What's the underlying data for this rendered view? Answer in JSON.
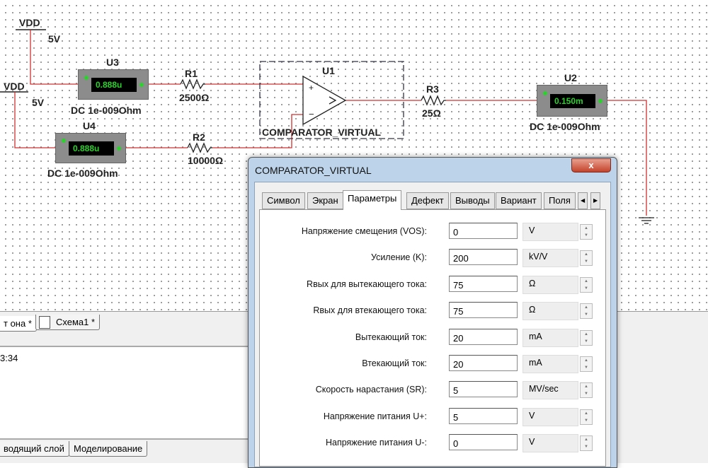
{
  "schematic": {
    "vdd": [
      {
        "label": "VDD",
        "voltage": "5V"
      },
      {
        "label": "VDD",
        "voltage": "5V"
      }
    ],
    "meters": [
      {
        "ref": "U3",
        "reading": "0.888u",
        "caption": "DC  1e-009Ohm"
      },
      {
        "ref": "U4",
        "reading": "0.888u",
        "caption": "DC  1e-009Ohm"
      },
      {
        "ref": "U2",
        "reading": "0.150m",
        "caption": "DC  1e-009Ohm"
      }
    ],
    "resistors": [
      {
        "ref": "R1",
        "value": "2500Ω"
      },
      {
        "ref": "R2",
        "value": "10000Ω"
      },
      {
        "ref": "R3",
        "value": "25Ω"
      }
    ],
    "comparator": {
      "ref": "U1",
      "name": "COMPARATOR_VIRTUAL",
      "plus": "+",
      "minus": "−"
    }
  },
  "colors": {
    "wire": "#d03030",
    "display_text": "#2dd12d"
  },
  "lower": {
    "doc_tabs": [
      "т она *",
      "Схема1 *"
    ],
    "output_text": "3:34",
    "bottom_tabs": [
      "водящий слой",
      "Моделирование"
    ]
  },
  "dialog": {
    "title": "COMPARATOR_VIRTUAL",
    "close": "x",
    "tabs": [
      "Символ",
      "Экран",
      "Параметры",
      "Дефект",
      "Выводы",
      "Вариант",
      "Поля"
    ],
    "active_tab": "Параметры",
    "params": [
      {
        "label": "Напряжение смещения (VOS):",
        "value": "0",
        "unit": "V"
      },
      {
        "label": "Усиление (K):",
        "value": "200",
        "unit": "kV/V"
      },
      {
        "label": "Rвых для вытекающего тока:",
        "value": "75",
        "unit": "Ω"
      },
      {
        "label": "Rвых для втекающего тока:",
        "value": "75",
        "unit": "Ω"
      },
      {
        "label": "Вытекающий ток:",
        "value": "20",
        "unit": "mA"
      },
      {
        "label": "Втекающий ток:",
        "value": "20",
        "unit": "mA"
      },
      {
        "label": "Скорость нарастания (SR):",
        "value": "5",
        "unit": "MV/sec"
      },
      {
        "label": "Напряжение питания U+:",
        "value": "5",
        "unit": "V"
      },
      {
        "label": "Напряжение питания U-:",
        "value": "0",
        "unit": "V"
      }
    ]
  }
}
